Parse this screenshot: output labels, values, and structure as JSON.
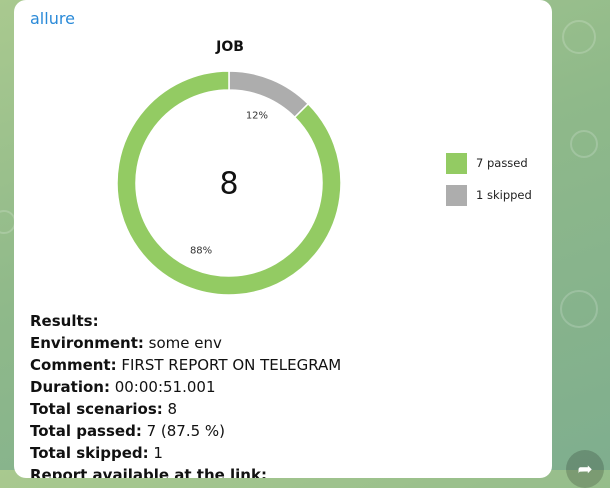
{
  "message": {
    "app_name": "allure"
  },
  "chart_data": {
    "type": "pie",
    "title": "JOB",
    "center_label": "8",
    "slices": [
      {
        "name": "7 passed",
        "value": 7,
        "percent_label": "88%",
        "color": "#93cb63"
      },
      {
        "name": "1 skipped",
        "value": 1,
        "percent_label": "12%",
        "color": "#adadad"
      }
    ],
    "legend_position": "right"
  },
  "results": {
    "header": "Results:",
    "rows": [
      {
        "label": "Environment:",
        "value": "some env"
      },
      {
        "label": "Comment:",
        "value": "FIRST REPORT ON TELEGRAM"
      },
      {
        "label": "Duration:",
        "value": "00:00:51.001"
      },
      {
        "label": "Total scenarios:",
        "value": "8"
      },
      {
        "label": "Total passed:",
        "value": "7 (87.5 %)"
      },
      {
        "label": "Total skipped:",
        "value": "1"
      }
    ],
    "truncated_line": "Report available at the link:"
  },
  "share_icon": "share-arrow-icon"
}
